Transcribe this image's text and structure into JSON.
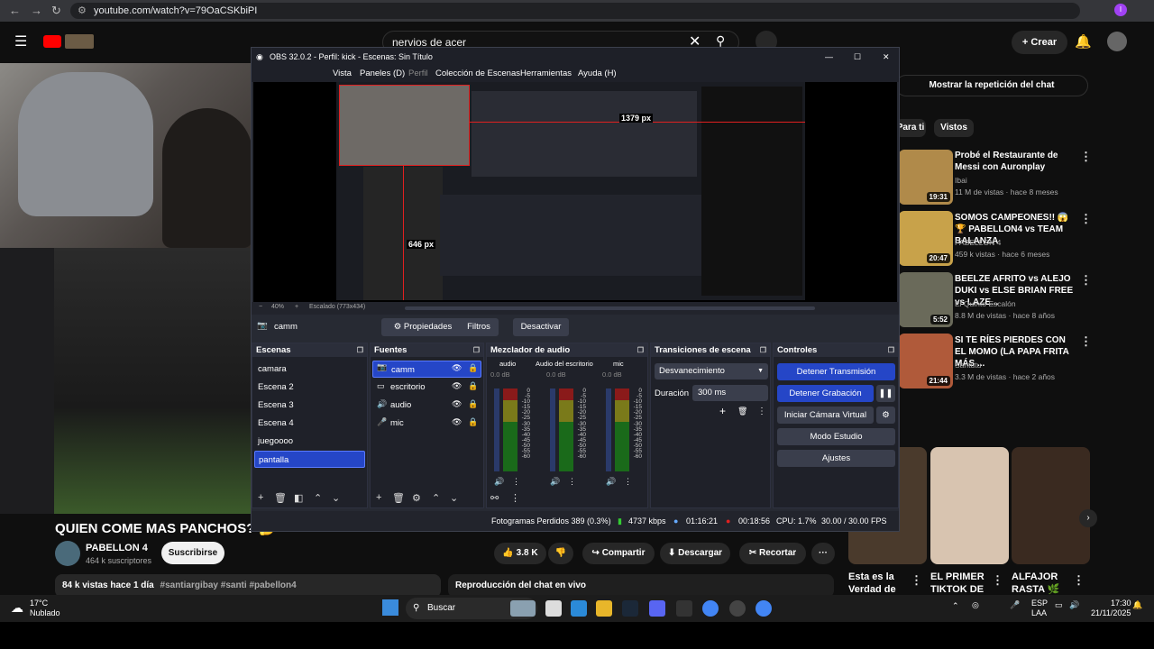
{
  "browser": {
    "url": "youtube.com/watch?v=79OaCSKbiPI"
  },
  "youtube": {
    "search_value": "nervios de acer",
    "create_label": "Crear",
    "video_title": "QUIEN COME MAS PANCHOS? 🤔",
    "channel_name": "PABELLON 4",
    "channel_subs": "464 k suscriptores",
    "subscribe_label": "Suscribirse",
    "like_count": "3.8 K",
    "share_label": "Compartir",
    "download_label": "Descargar",
    "clip_label": "Recortar",
    "description_meta": "84 k vistas  hace 1 día",
    "description_tags": "#santiargibay #santi #pabellon4",
    "chat_replay_bar": "Reproducción del chat en vivo",
    "show_chat_button": "Mostrar la repetición del chat",
    "chips": [
      "Para ti",
      "Vistos"
    ],
    "recommendations": [
      {
        "title": "Probé el Restaurante de Messi con Auronplay",
        "channel": "Ibai",
        "meta": "11 M de vistas · hace 8 meses",
        "duration": "19:31"
      },
      {
        "title": "SOMOS CAMPEONES!! 😱 🏆 PABELLON4 vs TEAM BALANZA",
        "channel": "PABELLON 4",
        "meta": "459 k vistas · hace 6 meses",
        "duration": "20:47"
      },
      {
        "title": "BEELZE AFRITO vs ALEJO DUKI vs ELSE BRIAN FREE vs LAZE...",
        "channel": "El Quinto Escalón",
        "meta": "8.8 M de vistas · hace 8 años",
        "duration": "5:52"
      },
      {
        "title": "SI TE RÍES PIERDES CON EL MOMO (LA PAPA FRITA MÁS ...",
        "channel": "Santutu",
        "meta": "3.3 M de vistas · hace 2 años",
        "duration": "21:44"
      }
    ],
    "shorts": [
      {
        "title": "Esta es la Verdad de l..."
      },
      {
        "title": "EL PRIMER TIKTOK DE ..."
      },
      {
        "title": "ALFAJOR RASTA 🌿"
      }
    ]
  },
  "obs": {
    "title": "OBS 32.0.2 - Perfil: kick - Escenas: Sin Título",
    "menu": [
      "Vista",
      "Paneles (D)",
      "Perfil",
      "Colección de Escenas",
      "Herramientas",
      "Ayuda (H)"
    ],
    "preview_width_label": "1379 px",
    "preview_height_label": "646 px",
    "zoom_value": "40%",
    "scale_label": "Escalado (773x434)",
    "selected_source": "camm",
    "properties_label": "Propiedades",
    "filters_label": "Filtros",
    "disable_label": "Desactivar",
    "docks": {
      "scenes": "Escenas",
      "sources": "Fuentes",
      "mixer": "Mezclador de audio",
      "transitions": "Transiciones de escena",
      "controls": "Controles"
    },
    "scenes": [
      "camara",
      "Escena 2",
      "Escena 3",
      "Escena 4",
      "juegoooo",
      "pantalla"
    ],
    "sources": [
      "camm",
      "escritorio",
      "audio",
      "mic"
    ],
    "mixer_channels": [
      {
        "name": "audio",
        "db": "0.0 dB"
      },
      {
        "name": "Audio del escritorio",
        "db": "0.0 dB"
      },
      {
        "name": "mic",
        "db": "0.0 dB"
      }
    ],
    "meter_scale": [
      "0",
      "-5",
      "-10",
      "-15",
      "-20",
      "-25",
      "-30",
      "-35",
      "-40",
      "-45",
      "-50",
      "-55",
      "-60"
    ],
    "transition_value": "Desvanecimiento",
    "duration_label": "Duración",
    "duration_value": "300 ms",
    "controls": [
      "Detener Transmisión",
      "Detener Grabación",
      "Iniciar Cámara Virtual",
      "Modo Estudio",
      "Ajustes"
    ],
    "status": {
      "dropped": "Fotogramas Perdidos 389 (0.3%)",
      "bitrate": "4737 kbps",
      "stream_time": "01:16:21",
      "rec_time": "00:18:56",
      "cpu": "CPU: 1.7%",
      "fps": "30.00 / 30.00 FPS"
    }
  },
  "taskbar": {
    "temp": "17°C",
    "weather": "Nublado",
    "search": "Buscar",
    "lang1": "ESP",
    "lang2": "LAA",
    "time": "17:30",
    "date": "21/11/2025"
  },
  "colors": {
    "obs_accent": "#2546c7",
    "yt_bg": "#0f0f0f",
    "rec_red": "#e02020"
  }
}
